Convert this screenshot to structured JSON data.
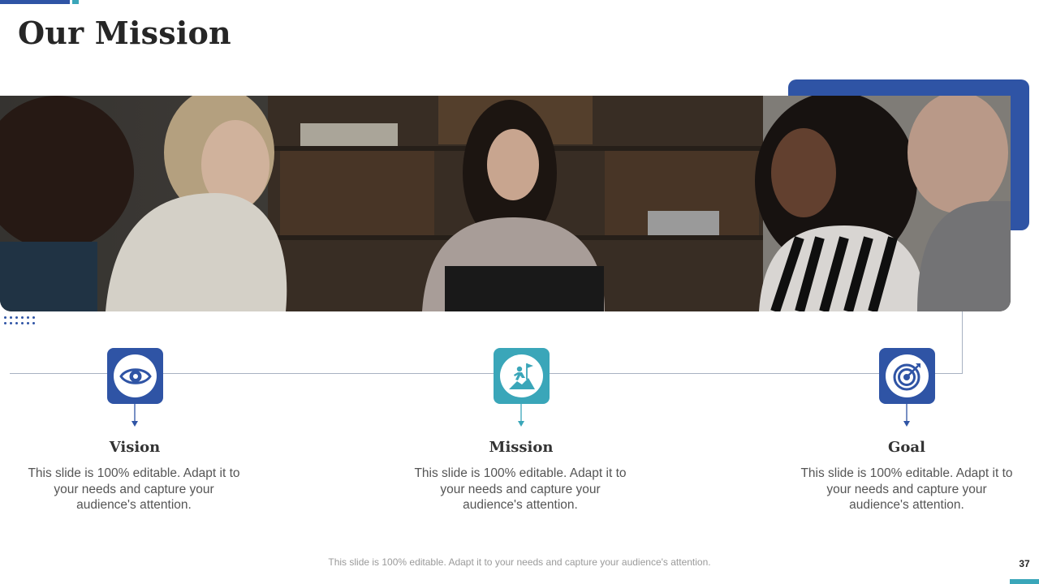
{
  "slide": {
    "title": "Our Mission",
    "footer_note": "This slide is 100% editable. Adapt it to your needs and capture your audience's attention.",
    "page_number": "37"
  },
  "colors": {
    "primary_blue": "#2f54a5",
    "teal": "#3aa6b9",
    "line_gray": "#a8b2c2"
  },
  "columns": [
    {
      "title": "Vision",
      "icon": "eye-icon",
      "text": "This slide is 100% editable. Adapt it to your needs and capture your audience's attention."
    },
    {
      "title": "Mission",
      "icon": "climber-flag-icon",
      "text": "This slide is 100% editable. Adapt it to your needs and capture your audience's attention."
    },
    {
      "title": "Goal",
      "icon": "target-icon",
      "text": "This slide is 100% editable. Adapt it to your needs and capture your audience's attention."
    }
  ]
}
